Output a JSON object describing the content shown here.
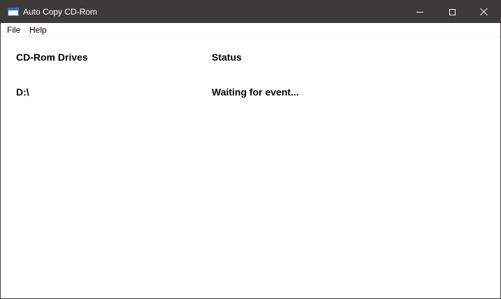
{
  "window": {
    "title": "Auto Copy CD-Rom",
    "icon": "app-window-icon",
    "controls": {
      "minimize_icon": "minimize-icon",
      "maximize_icon": "maximize-icon",
      "close_icon": "close-icon"
    }
  },
  "menu": {
    "items": [
      {
        "label": "File"
      },
      {
        "label": "Help"
      }
    ]
  },
  "table": {
    "headers": [
      "CD-Rom Drives",
      "Status"
    ],
    "rows": [
      {
        "drive": "D:\\",
        "status": "Waiting for event..."
      }
    ]
  },
  "colors": {
    "titlebar": "#3c3b39",
    "background": "#ffffff",
    "text": "#000000"
  }
}
